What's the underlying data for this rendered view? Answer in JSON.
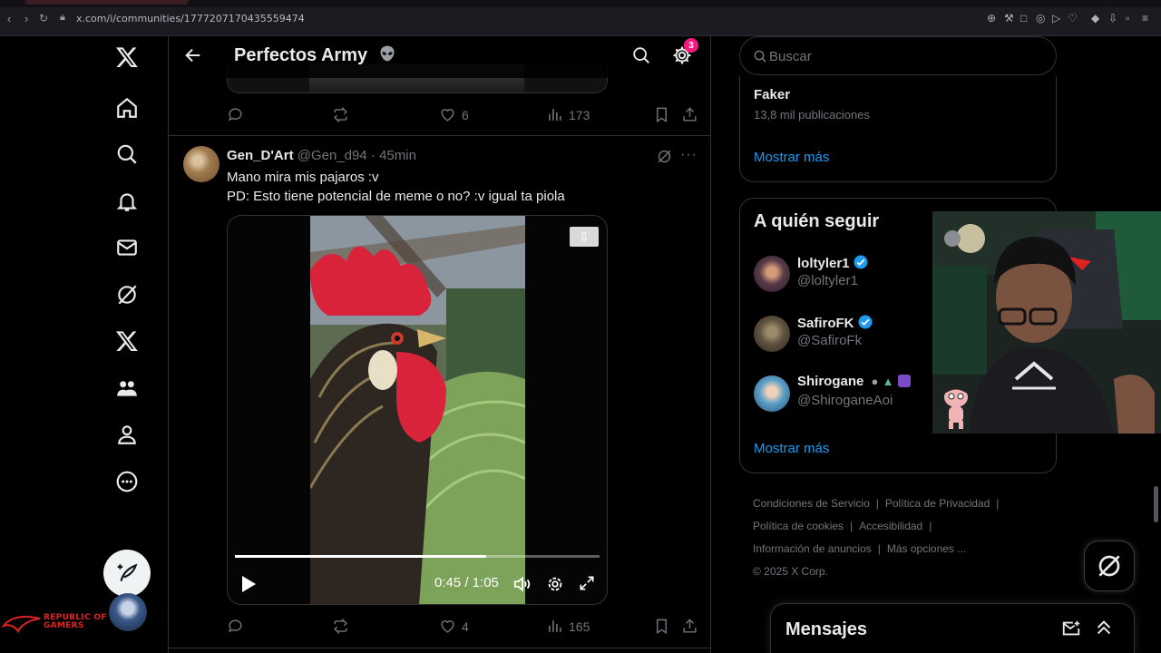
{
  "browser": {
    "url": "x.com/i/communities/1777207170435559474"
  },
  "nav": {
    "items": [
      "home-icon",
      "explore-icon",
      "notifications-icon",
      "messages-icon",
      "grok-icon",
      "premium-icon",
      "communities-icon",
      "profile-icon",
      "more-icon"
    ]
  },
  "overlay": {
    "rog_line1": "REPUBLIC OF",
    "rog_line2": "GAMERS"
  },
  "header": {
    "title": "Perfectos Army",
    "settings_badge": "3"
  },
  "prev_tweet": {
    "likes": "6",
    "views": "173"
  },
  "tweet": {
    "name": "Gen_D'Art",
    "handle": "@Gen_d94",
    "separator": "·",
    "time": "45min",
    "line1": "Mano mira mis pajaros :v",
    "line2": "PD: Esto tiene potencial de meme o no? :v igual ta piola",
    "video": {
      "current": "0:45",
      "duration": "1:05",
      "time_display": "0:45 / 1:05",
      "progress_fraction": 0.69
    },
    "likes": "4",
    "views": "165"
  },
  "sidebar": {
    "search_placeholder": "Buscar",
    "trend": {
      "name": "Faker",
      "count": "13,8 mil publicaciones",
      "show_more": "Mostrar más"
    },
    "who_to_follow": {
      "title": "A quién seguir",
      "users": [
        {
          "name": "loltyler1",
          "handle": "@loltyler1",
          "verified": true
        },
        {
          "name": "SafiroFK",
          "handle": "@SafiroFk",
          "verified": true
        },
        {
          "name": "Shirogane",
          "handle": "@ShiroganeAoi",
          "verified": false
        }
      ],
      "show_more": "Mostrar más"
    },
    "footer": {
      "terms": "Condiciones de Servicio",
      "privacy": "Política de Privacidad",
      "cookies": "Política de cookies",
      "accessibility": "Accesibilidad",
      "ads": "Información de anuncios",
      "more": "Más opciones ...",
      "copyright": "© 2025 X Corp."
    }
  },
  "messages": {
    "title": "Mensajes"
  },
  "colors": {
    "accent": "#1d9bf0",
    "badge": "#f91880",
    "border": "#2f3336",
    "muted": "#71767b",
    "text": "#e7e9ea"
  }
}
